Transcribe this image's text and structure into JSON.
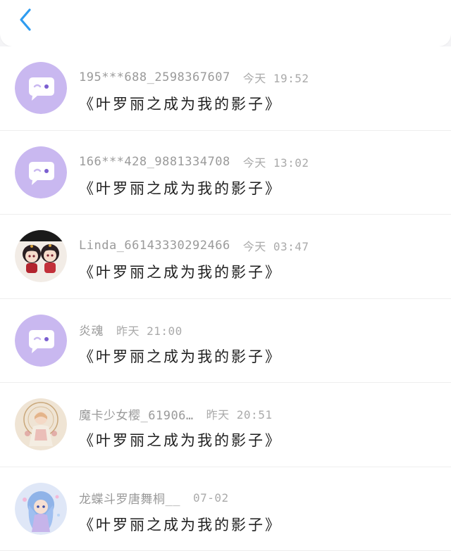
{
  "header": {
    "back_icon": "chevron-left-icon",
    "accent_color": "#2f9cf0"
  },
  "colors": {
    "default_avatar_bg": "#c9b8f0",
    "row_bg": "#ffffff",
    "page_bg": "#f4f4f6"
  },
  "messages": [
    {
      "username": "195***688_2598367607",
      "time": "今天 19:52",
      "content": "《叶罗丽之成为我的影子》",
      "avatar": "default-chat-bubble-avatar"
    },
    {
      "username": "166***428_9881334708",
      "time": "今天 13:02",
      "content": "《叶罗丽之成为我的影子》",
      "avatar": "default-chat-bubble-avatar"
    },
    {
      "username": "Linda_66143330292466",
      "time": "今天 03:47",
      "content": "《叶罗丽之成为我的影子》",
      "avatar": "two-anime-girls-avatar"
    },
    {
      "username": "炎魂",
      "time": "昨天 21:00",
      "content": "《叶罗丽之成为我的影子》",
      "avatar": "default-chat-bubble-avatar"
    },
    {
      "username": "魔卡少女樱_61906…",
      "time": "昨天 20:51",
      "content": "《叶罗丽之成为我的影子》",
      "avatar": "fairy-anime-girl-avatar"
    },
    {
      "username": "龙蝶斗罗唐舞桐__",
      "time": "07-02",
      "content": "《叶罗丽之成为我的影子》",
      "avatar": "blue-haired-anime-girl-avatar"
    }
  ]
}
